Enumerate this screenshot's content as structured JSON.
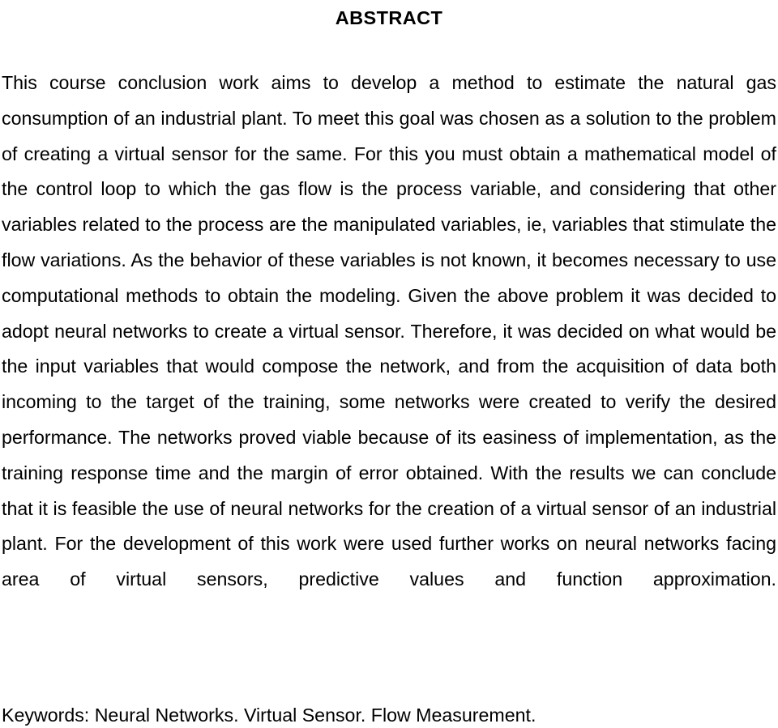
{
  "document": {
    "heading": "ABSTRACT",
    "abstract_paragraph": "This course conclusion work aims to develop a method to estimate the natural gas consumption of an industrial plant. To meet this goal was chosen as a solution to the problem of creating a virtual sensor for the same. For this you must obtain a mathematical model of the control loop to which the gas flow is the process variable, and considering that other variables related to the process are the manipulated variables, ie, variables that stimulate the flow variations. As the behavior of these variables is not known, it becomes necessary to use computational methods to obtain the modeling. Given the above problem it was decided to adopt neural networks to create a virtual sensor. Therefore, it was decided on what would be the input variables that would compose the network, and from the acquisition of data both incoming to the target of the training, some networks were created to verify the desired performance. The networks proved viable because of its easiness of implementation, as the training response time and the margin of error obtained. With the results we can conclude that it is feasible the use of neural networks for the creation of a virtual sensor of an industrial plant. For the development of this work were used further works on neural networks facing area of virtual sensors, predictive values and function approximation.",
    "keywords_line": "Keywords: Neural Networks. Virtual Sensor. Flow Measurement.",
    "keywords_label": "Keywords:",
    "keywords": [
      "Neural Networks.",
      "Virtual Sensor.",
      "Flow Measurement."
    ],
    "lines": [
      "This course conclusion work aims to develop a method to estimate the natural gas",
      "consumption of an industrial plant. To meet this goal was chosen as a solution to the",
      "problem of creating a virtual sensor for the same. For this you must obtain a",
      "mathematical model of the control loop to which the gas flow is the process variable,",
      "and considering that other variables related to the process are the manipulated",
      "variables, ie, variables that stimulate the flow variations. As the behavior of these",
      "variables is not known, it becomes necessary to use computational methods to",
      "obtain the modeling. Given the above problem it was decided to adopt neural",
      "networks to create a virtual sensor. Therefore, it was decided on what would be the",
      "input variables that would compose the network, and from the acquisition of data",
      "both incoming to the target of the training, some networks were created to verify the",
      "desired performance. The networks proved viable because of its easiness of",
      "implementation, as the training response time and the margin of error obtained. With",
      "the results we can conclude that it is feasible the use of neural networks for the",
      "creation of a virtual sensor of an industrial plant. For the development of this work",
      "were used further works on neural networks facing area of virtual sensors, predictive",
      "values and function approximation."
    ]
  },
  "style": {
    "text_color": "#000000",
    "background_color": "#ffffff"
  }
}
